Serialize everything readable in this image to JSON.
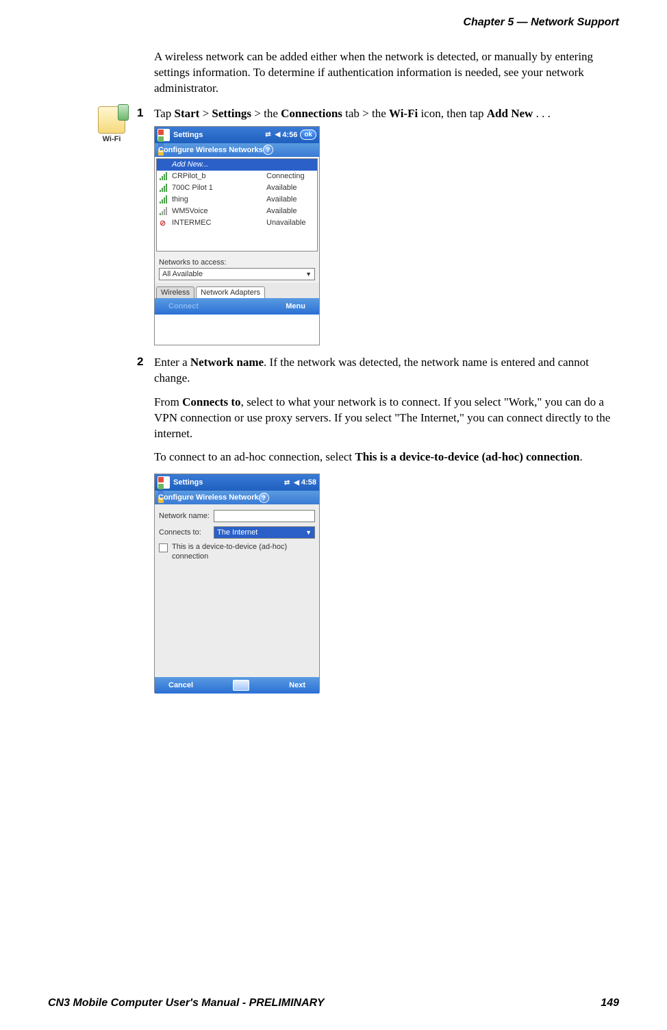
{
  "header": "Chapter 5 —  Network Support",
  "intro": "A wireless network can be added either when the network is detected, or manually by entering settings information. To determine if authentication information is needed, see your network administrator.",
  "wifi_icon_label": "Wi-Fi",
  "step1": {
    "num": "1",
    "parts": [
      "Tap ",
      "Start",
      " > ",
      "Settings",
      " > the ",
      "Connections",
      " tab > the ",
      "Wi-Fi",
      " icon, then tap ",
      "Add New",
      " . . ."
    ]
  },
  "step2": {
    "num": "2",
    "p1_parts": [
      "Enter a ",
      "Network name",
      ". If the network was detected, the network name is entered and cannot change."
    ],
    "p2_parts": [
      "From ",
      "Connects to",
      ", select to what your network is to connect. If you select \"Work,\" you can do a VPN connection or use proxy servers. If you select \"The Internet,\" you can connect directly to the internet."
    ],
    "p3_parts": [
      "To connect to an ad-hoc connection, select ",
      "This is a device-to-device (ad-hoc) connection",
      "."
    ]
  },
  "ss1": {
    "title": "Settings",
    "time": "4:56",
    "ok": "ok",
    "subtitle": "Configure Wireless Networks",
    "rows": [
      {
        "name": "Add New...",
        "status": "",
        "selected": true
      },
      {
        "name": "CRPilot_b",
        "status": "Connecting",
        "sig": "high"
      },
      {
        "name": "700C Pilot 1",
        "status": "Available",
        "sig": "high"
      },
      {
        "name": "thing",
        "status": "Available",
        "sig": "high"
      },
      {
        "name": "WM5Voice",
        "status": "Available",
        "sig": "low"
      },
      {
        "name": "INTERMEC",
        "status": "Unavailable",
        "sig": "x"
      }
    ],
    "access_label": "Networks to access:",
    "access_value": "All Available",
    "tabs": [
      "Wireless",
      "Network Adapters"
    ],
    "footer_left": "Connect",
    "footer_right": "Menu"
  },
  "ss2": {
    "title": "Settings",
    "time": "4:58",
    "subtitle": "Configure Wireless Network",
    "label_name": "Network name:",
    "label_connects": "Connects to:",
    "connects_value": "The Internet",
    "checkbox_label": "This is a device-to-device (ad-hoc) connection",
    "footer_left": "Cancel",
    "footer_right": "Next"
  },
  "footer_left": "CN3 Mobile Computer User's Manual - PRELIMINARY",
  "footer_right": "149"
}
